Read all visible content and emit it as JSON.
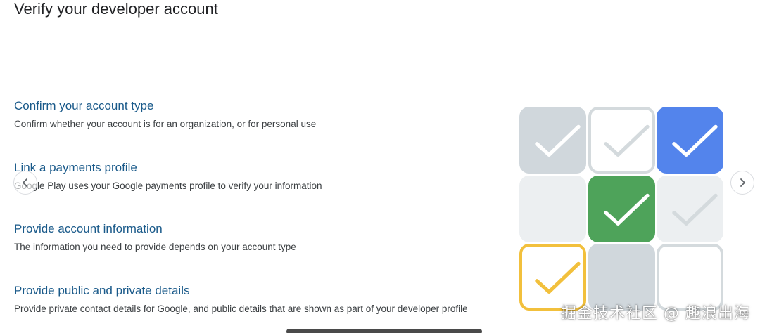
{
  "page": {
    "title": "Verify your developer account"
  },
  "steps": [
    {
      "title": "Confirm your account type",
      "description": "Confirm whether your account is for an organization, or for personal use"
    },
    {
      "title": "Link a payments profile",
      "description": "Google Play uses your Google payments profile to verify your information"
    },
    {
      "title": "Provide account information",
      "description": "The information you need to provide depends on your account type"
    },
    {
      "title": "Provide public and private details",
      "description": "Provide private contact details for Google, and public details that are shown as part of your developer profile"
    }
  ],
  "carousel": {
    "prev_icon": "chevron-left-icon",
    "next_icon": "chevron-right-icon"
  },
  "illustration": {
    "tiles": [
      {
        "fill": "#d0d7dc",
        "border": "#d0d7dc",
        "check": "#ffffff"
      },
      {
        "fill": "#ffffff",
        "border": "#d4dadd",
        "check": "#d4dadd"
      },
      {
        "fill": "#5384ec",
        "border": "#5384ec",
        "check": "#ffffff"
      },
      {
        "fill": "#eceff1",
        "border": "#eceff1",
        "check": null
      },
      {
        "fill": "#4ea35a",
        "border": "#4ea35a",
        "check": "#ffffff"
      },
      {
        "fill": "#eceff1",
        "border": "#eceff1",
        "check": "#d4dadd"
      },
      {
        "fill": "#ffffff",
        "border": "#f2c03c",
        "check": "#f2c03c"
      },
      {
        "fill": "#d0d7dc",
        "border": "#d0d7dc",
        "check": null
      },
      {
        "fill": "#ffffff",
        "border": "#d4dadd",
        "check": null
      }
    ]
  },
  "watermark": {
    "text": "掘金技术社区 @ 趣浪出海"
  }
}
